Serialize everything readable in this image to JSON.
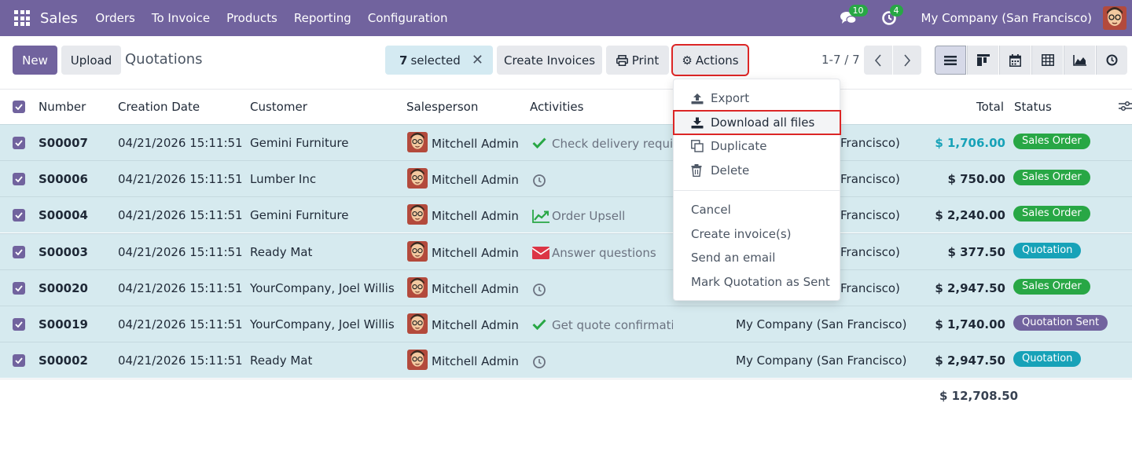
{
  "navbar": {
    "brand": "Sales",
    "menus": [
      "Orders",
      "To Invoice",
      "Products",
      "Reporting",
      "Configuration"
    ],
    "chat_badge": "10",
    "activity_badge": "4",
    "company": "My Company (San Francisco)",
    "bg_color": "#71639e"
  },
  "control": {
    "new_label": "New",
    "upload_label": "Upload",
    "title": "Quotations",
    "selected_count": "7",
    "selected_label": "selected",
    "create_invoices_label": "Create Invoices",
    "print_label": "Print",
    "actions_label": "Actions",
    "pager": "1-7 / 7"
  },
  "columns": {
    "number": "Number",
    "creation_date": "Creation Date",
    "customer": "Customer",
    "salesperson": "Salesperson",
    "activities": "Activities",
    "total": "Total",
    "status": "Status"
  },
  "rows": [
    {
      "number": "S00007",
      "date": "04/21/2026 15:11:51",
      "customer": "Gemini Furniture",
      "salesperson": "Mitchell Admin",
      "activity": "Check delivery requir",
      "activity_icon": "check-icon",
      "company": "Francisco)",
      "total": "$ 1,706.00",
      "status": "Sales Order"
    },
    {
      "number": "S00006",
      "date": "04/21/2026 15:11:51",
      "customer": "Lumber Inc",
      "salesperson": "Mitchell Admin",
      "activity": "",
      "activity_icon": "clock-icon",
      "company": "Francisco)",
      "total": "$ 750.00",
      "status": "Sales Order"
    },
    {
      "number": "S00004",
      "date": "04/21/2026 15:11:51",
      "customer": "Gemini Furniture",
      "salesperson": "Mitchell Admin",
      "activity": "Order Upsell",
      "activity_icon": "chart-up-icon",
      "company": "Francisco)",
      "total": "$ 2,240.00",
      "status": "Sales Order"
    },
    {
      "number": "S00003",
      "date": "04/21/2026 15:11:51",
      "customer": "Ready Mat",
      "salesperson": "Mitchell Admin",
      "activity": "Answer questions",
      "activity_icon": "envelope-icon",
      "company": "Francisco)",
      "total": "$ 377.50",
      "status": "Quotation"
    },
    {
      "number": "S00020",
      "date": "04/21/2026 15:11:51",
      "customer": "YourCompany, Joel Willis",
      "salesperson": "Mitchell Admin",
      "activity": "",
      "activity_icon": "clock-icon",
      "company": "Francisco)",
      "total": "$ 2,947.50",
      "status": "Sales Order"
    },
    {
      "number": "S00019",
      "date": "04/21/2026 15:11:51",
      "customer": "YourCompany, Joel Willis",
      "salesperson": "Mitchell Admin",
      "activity": "Get quote confirmation",
      "activity_icon": "check-icon",
      "company": "My Company (San Francisco)",
      "total": "$ 1,740.00",
      "status": "Quotation Sent"
    },
    {
      "number": "S00002",
      "date": "04/21/2026 15:11:51",
      "customer": "Ready Mat",
      "salesperson": "Mitchell Admin",
      "activity": "",
      "activity_icon": "clock-icon",
      "company": "My Company (San Francisco)",
      "total": "$ 2,947.50",
      "status": "Quotation"
    }
  ],
  "status_colors": {
    "Sales Order": "#28a745",
    "Quotation": "#17a2b8",
    "Quotation Sent": "#71639e"
  },
  "grand_total": "$ 12,708.50",
  "dropdown": {
    "export": "Export",
    "download_all_files": "Download all files",
    "duplicate": "Duplicate",
    "delete": "Delete",
    "cancel": "Cancel",
    "create_invoices": "Create invoice(s)",
    "send_email": "Send an email",
    "mark_sent": "Mark Quotation as Sent"
  }
}
